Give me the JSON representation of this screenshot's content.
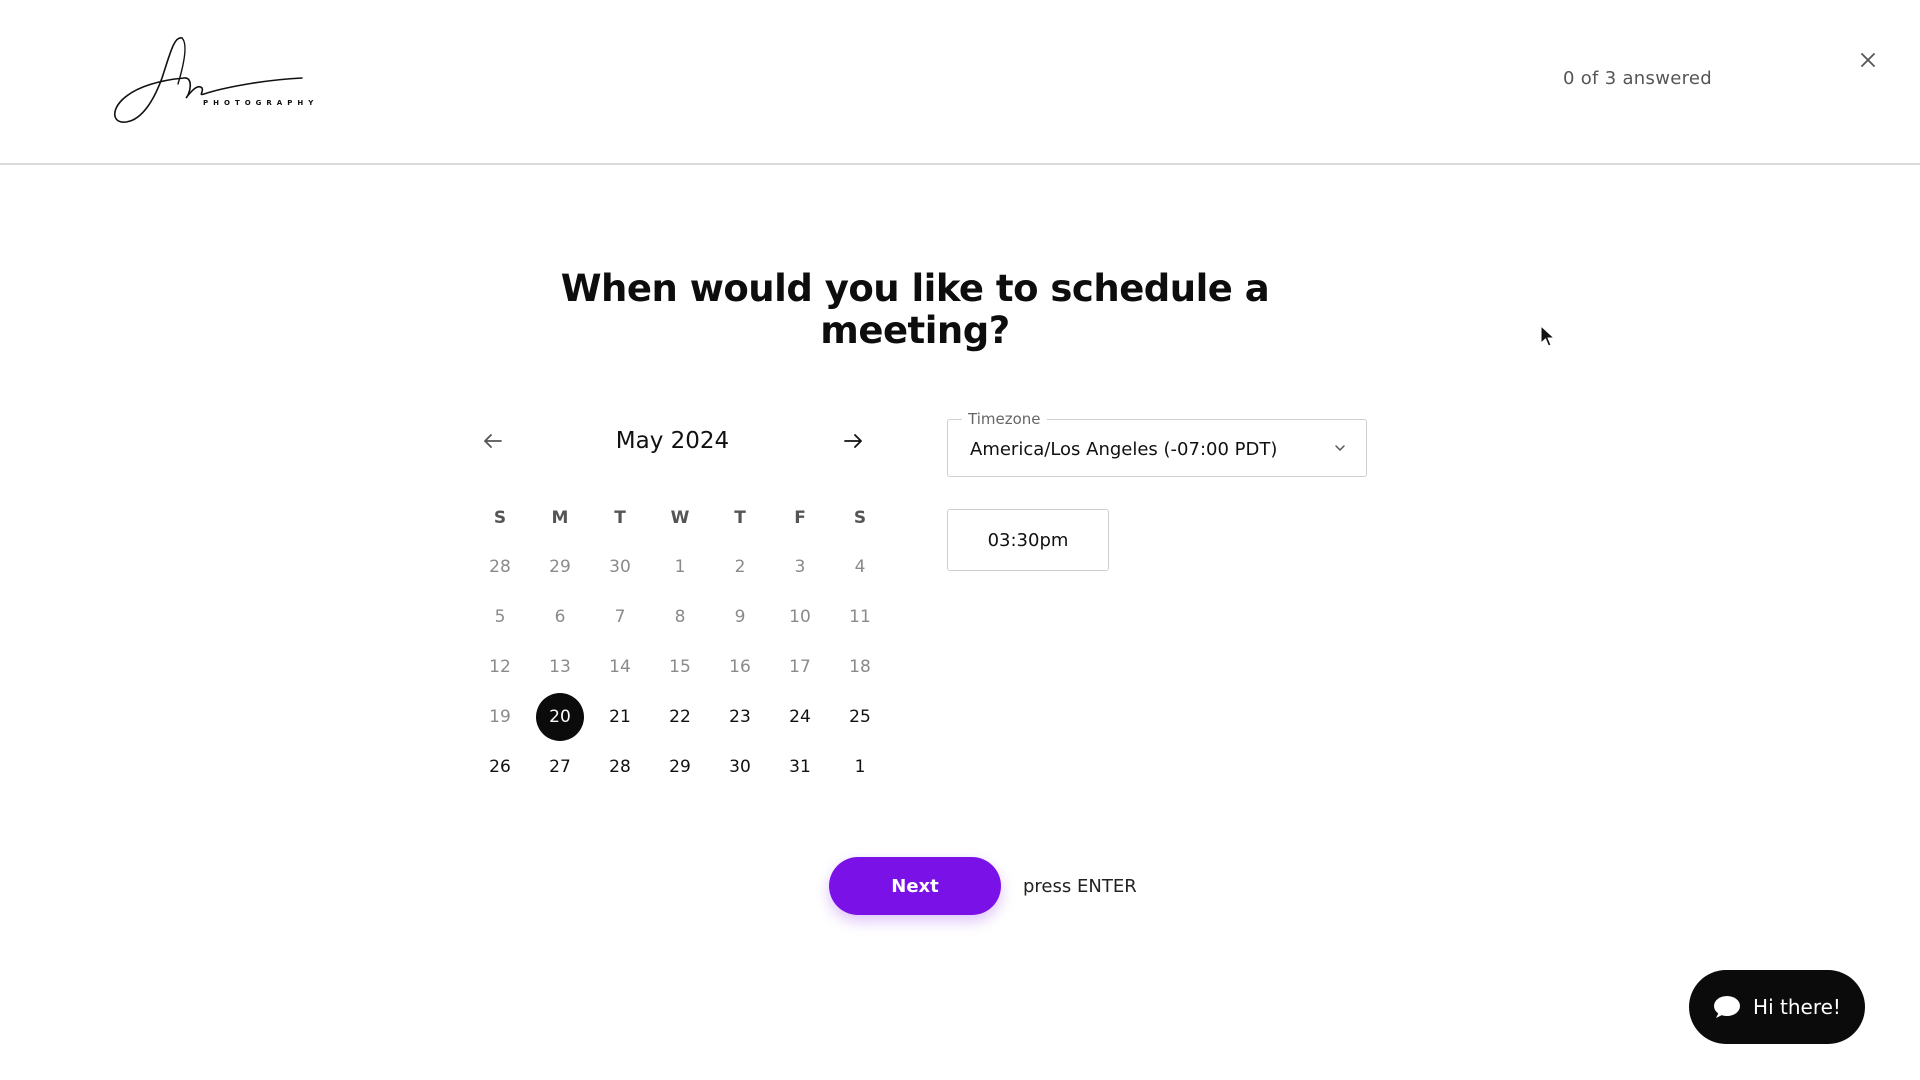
{
  "header": {
    "logo_text": "PHOTOGRAPHY",
    "progress": "0 of 3 answered"
  },
  "question": "When would you like to schedule a meeting?",
  "calendar": {
    "month": "May 2024",
    "weekdays": [
      "S",
      "M",
      "T",
      "W",
      "T",
      "F",
      "S"
    ],
    "weeks": [
      [
        {
          "d": "28",
          "state": "muted"
        },
        {
          "d": "29",
          "state": "muted"
        },
        {
          "d": "30",
          "state": "muted"
        },
        {
          "d": "1",
          "state": "muted"
        },
        {
          "d": "2",
          "state": "muted"
        },
        {
          "d": "3",
          "state": "muted"
        },
        {
          "d": "4",
          "state": "muted"
        }
      ],
      [
        {
          "d": "5",
          "state": "muted"
        },
        {
          "d": "6",
          "state": "muted"
        },
        {
          "d": "7",
          "state": "muted"
        },
        {
          "d": "8",
          "state": "muted"
        },
        {
          "d": "9",
          "state": "muted"
        },
        {
          "d": "10",
          "state": "muted"
        },
        {
          "d": "11",
          "state": "muted"
        }
      ],
      [
        {
          "d": "12",
          "state": "muted"
        },
        {
          "d": "13",
          "state": "muted"
        },
        {
          "d": "14",
          "state": "muted"
        },
        {
          "d": "15",
          "state": "muted"
        },
        {
          "d": "16",
          "state": "muted"
        },
        {
          "d": "17",
          "state": "muted"
        },
        {
          "d": "18",
          "state": "muted"
        }
      ],
      [
        {
          "d": "19",
          "state": "muted"
        },
        {
          "d": "20",
          "state": "selected"
        },
        {
          "d": "21",
          "state": "active"
        },
        {
          "d": "22",
          "state": "active"
        },
        {
          "d": "23",
          "state": "active"
        },
        {
          "d": "24",
          "state": "active"
        },
        {
          "d": "25",
          "state": "active"
        }
      ],
      [
        {
          "d": "26",
          "state": "active"
        },
        {
          "d": "27",
          "state": "active"
        },
        {
          "d": "28",
          "state": "active"
        },
        {
          "d": "29",
          "state": "active"
        },
        {
          "d": "30",
          "state": "active"
        },
        {
          "d": "31",
          "state": "active"
        },
        {
          "d": "1",
          "state": "active"
        }
      ]
    ]
  },
  "timezone": {
    "label": "Timezone",
    "value": "America/Los Angeles (-07:00 PDT)"
  },
  "time_slots": [
    "03:30pm"
  ],
  "actions": {
    "next_label": "Next",
    "hint": "press ENTER"
  },
  "chat": {
    "label": "Hi there!"
  },
  "colors": {
    "accent": "#7a12e8",
    "selected_day": "#0b0b0b",
    "chat_bg": "#0b0b0b"
  }
}
